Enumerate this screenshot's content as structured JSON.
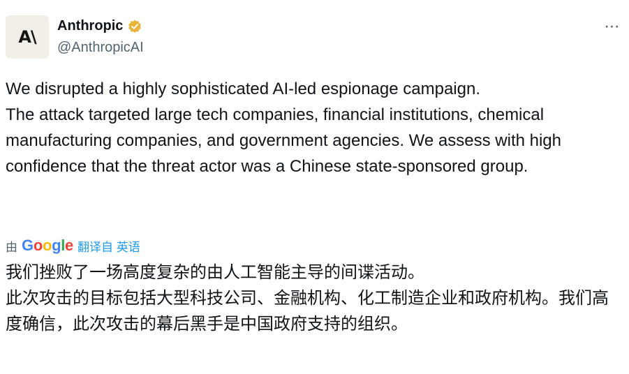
{
  "author": {
    "display_name": "Anthropic",
    "handle": "@AnthropicAI",
    "avatar_text": "A\\",
    "verified_icon": "verified-badge-icon",
    "verified_color": "#e8b339"
  },
  "more_icon": "more-horizontal-icon",
  "tweet": {
    "paragraphs": [
      "We disrupted a highly sophisticated AI-led espionage campaign.",
      "",
      "The attack targeted large tech companies, financial institutions, chemical manufacturing companies, and government agencies. We assess with high confidence that the threat actor was a Chinese state-sponsored group."
    ]
  },
  "translation": {
    "by_label": "由",
    "google_letters": [
      {
        "ch": "G",
        "color": "#4285F4"
      },
      {
        "ch": "o",
        "color": "#EA4335"
      },
      {
        "ch": "o",
        "color": "#FBBC05"
      },
      {
        "ch": "g",
        "color": "#4285F4"
      },
      {
        "ch": "l",
        "color": "#34A853"
      },
      {
        "ch": "e",
        "color": "#EA4335"
      }
    ],
    "link_label": "翻译自 英语",
    "paragraphs": [
      "我们挫败了一场高度复杂的由人工智能主导的间谍活动。",
      "",
      "此次攻击的目标包括大型科技公司、金融机构、化工制造企业和政府机构。我们高度确信，此次攻击的幕后黑手是中国政府支持的组织。"
    ]
  },
  "colors": {
    "text_primary": "#0f1419",
    "text_secondary": "#536471",
    "link": "#1d9bf0"
  }
}
